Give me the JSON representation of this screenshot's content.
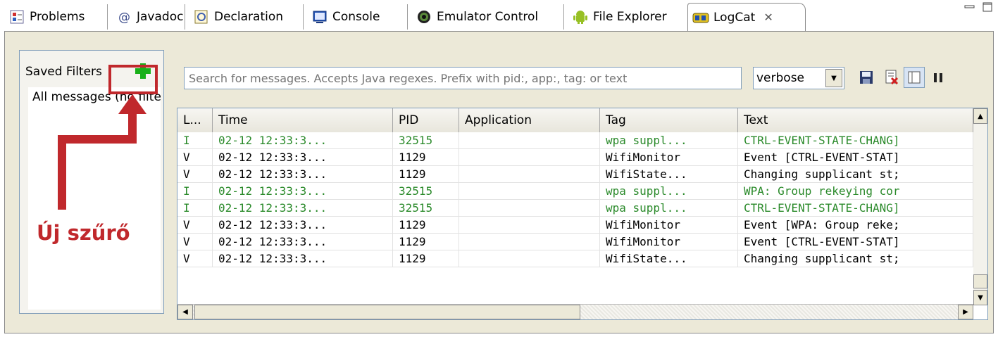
{
  "tabs": [
    {
      "label": "Problems",
      "icon": "problems-icon"
    },
    {
      "label": "Javadoc",
      "icon": "at-icon"
    },
    {
      "label": "Declaration",
      "icon": "declaration-icon"
    },
    {
      "label": "Console",
      "icon": "console-icon"
    },
    {
      "label": "Emulator Control",
      "icon": "emulator-icon"
    },
    {
      "label": "File Explorer",
      "icon": "android-icon"
    },
    {
      "label": "LogCat",
      "icon": "logcat-icon",
      "active": true
    }
  ],
  "tab_close": "✕",
  "filters": {
    "header": "Saved Filters",
    "items": [
      "All messages (no filters)"
    ]
  },
  "search": {
    "placeholder": "Search for messages. Accepts Java regexes. Prefix with pid:, app:, tag: or text"
  },
  "level": {
    "selected": "verbose"
  },
  "table": {
    "columns": [
      "L...",
      "Time",
      "PID",
      "Application",
      "Tag",
      "Text"
    ],
    "rows": [
      {
        "level": "I",
        "time": "02-12 12:33:3...",
        "pid": "32515",
        "app": "",
        "tag": "wpa suppl...",
        "text": "CTRL-EVENT-STATE-CHANG]"
      },
      {
        "level": "V",
        "time": "02-12 12:33:3...",
        "pid": "1129",
        "app": "",
        "tag": "WifiMonitor",
        "text": "Event [CTRL-EVENT-STAT]"
      },
      {
        "level": "V",
        "time": "02-12 12:33:3...",
        "pid": "1129",
        "app": "",
        "tag": "WifiState...",
        "text": "Changing supplicant st;"
      },
      {
        "level": "I",
        "time": "02-12 12:33:3...",
        "pid": "32515",
        "app": "",
        "tag": "wpa suppl...",
        "text": "WPA: Group rekeying cor"
      },
      {
        "level": "I",
        "time": "02-12 12:33:3...",
        "pid": "32515",
        "app": "",
        "tag": "wpa suppl...",
        "text": "CTRL-EVENT-STATE-CHANG]"
      },
      {
        "level": "V",
        "time": "02-12 12:33:3...",
        "pid": "1129",
        "app": "",
        "tag": "WifiMonitor",
        "text": "Event [WPA: Group reke;"
      },
      {
        "level": "V",
        "time": "02-12 12:33:3...",
        "pid": "1129",
        "app": "",
        "tag": "WifiMonitor",
        "text": "Event [CTRL-EVENT-STAT]"
      },
      {
        "level": "V",
        "time": "02-12 12:33:3...",
        "pid": "1129",
        "app": "",
        "tag": "WifiState...",
        "text": "Changing supplicant st;"
      }
    ]
  },
  "annotation": {
    "label": "Új szűrő"
  },
  "colors": {
    "annotation": "#c0282c",
    "info_row": "#2a8a2a",
    "add_icon": "#18b018"
  }
}
